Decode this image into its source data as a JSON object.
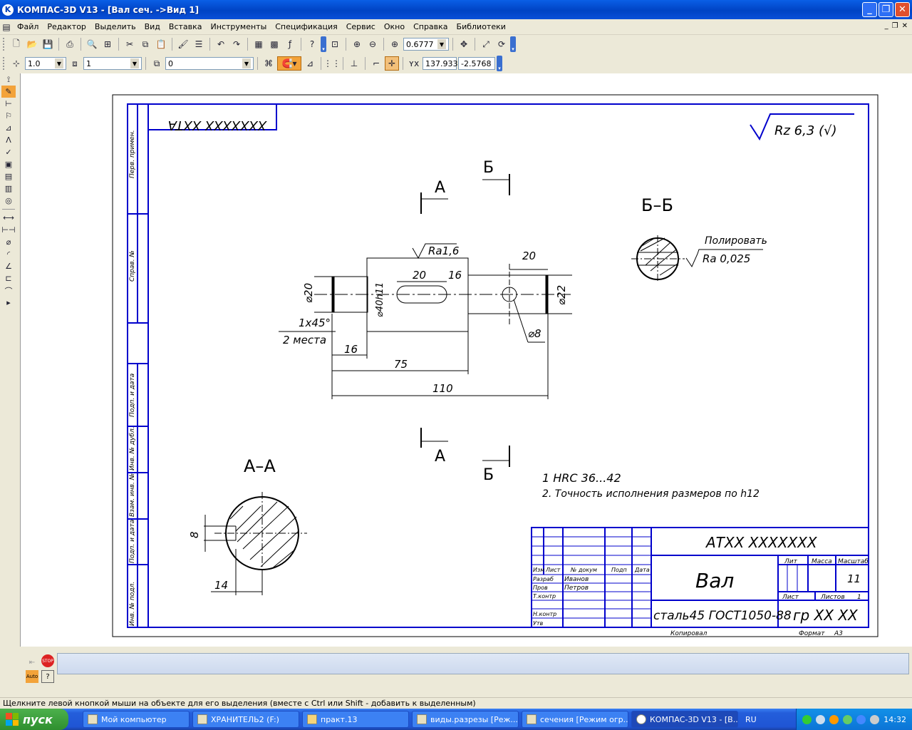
{
  "window": {
    "title": "КОМПАС-3D V13 - [Вал сеч. ->Вид 1]",
    "app_letter": "K"
  },
  "menu": [
    "Файл",
    "Редактор",
    "Выделить",
    "Вид",
    "Вставка",
    "Инструменты",
    "Спецификация",
    "Сервис",
    "Окно",
    "Справка",
    "Библиотеки"
  ],
  "toolbar": {
    "zoom": "0.6777"
  },
  "props": {
    "step": "1.0",
    "layer": "1",
    "style": "0",
    "x": "137.933",
    "y": "-2.5768"
  },
  "drawing": {
    "doc_code_rotated": "XXXXXXX XXTA",
    "roughness_general": "Rz 6,3 (√)",
    "cut_a": "А",
    "cut_b": "Б",
    "section_bb": "Б–Б",
    "section_aa": "А–А",
    "polish_note": "Полировать",
    "ra_polish": "Ra 0,025",
    "ra_shaft": "Ra1,6",
    "dims": {
      "d20": "⌀20",
      "d22": "⌀22",
      "d40": "⌀40h11",
      "d8": "⌀8",
      "l20a": "20",
      "l20b": "20",
      "l16": "16",
      "l16b": "16",
      "l75": "75",
      "l110": "110",
      "chamfer": "1x45°",
      "places": "2 места",
      "aa8": "8",
      "aa14": "14"
    },
    "side_labels": [
      "Перв. примен.",
      "Справ. №",
      "Подп. и дата",
      "Инв. № дубл.",
      "Взам. инв. №",
      "Подп. и дата",
      "Инв. № подл."
    ],
    "notes": [
      "1 HRC 36...42",
      "2. Точность исполнения размеров по h12"
    ],
    "stamp": {
      "code": "АТХХ ХХХХХХХ",
      "name": "Вал",
      "material": "сталь45 ГОСТ1050-88",
      "group": "гр ХХ ХХ",
      "scale": "11",
      "sheets_label": "Листов",
      "sheets": "1",
      "sheet_label": "Лист",
      "lit": "Лит",
      "mass": "Масса",
      "masshtab": "Масштаб",
      "cols": [
        "Изм",
        "Лист",
        "№ докум",
        "Подп",
        "Дата"
      ],
      "roles": [
        "Разраб",
        "Пров",
        "Т.контр",
        "Н.контр",
        "Утв"
      ],
      "names": [
        "Иванов",
        "Петров"
      ],
      "copied": "Копировал",
      "format_label": "Формат",
      "format": "А3"
    }
  },
  "status": "Щелкните левой кнопкой мыши на объекте для его выделения (вместе с Ctrl или Shift - добавить к выделенным)",
  "taskbar": {
    "start": "пуск",
    "tasks": [
      "Мой компьютер",
      "ХРАНИТЕЛЬ2 (F:)",
      "практ.13",
      "виды.разрезы [Реж...",
      "сечения [Режим огр...",
      "КОМПАС-3D V13 - [В..."
    ],
    "lang": "RU",
    "time": "14:32"
  }
}
